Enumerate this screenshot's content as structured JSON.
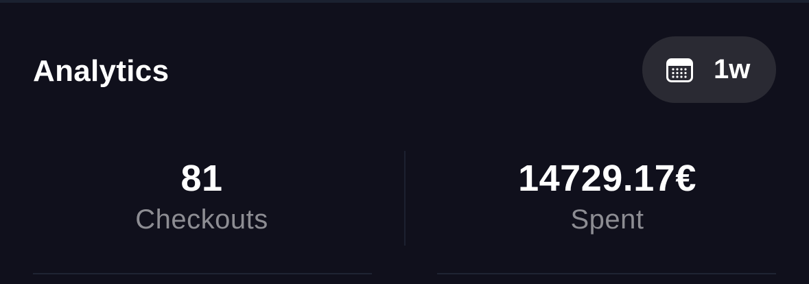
{
  "header": {
    "title": "Analytics"
  },
  "period_selector": {
    "icon": "calendar-icon",
    "value": "1w"
  },
  "stats": {
    "checkouts": {
      "value": "81",
      "label": "Checkouts"
    },
    "spent": {
      "value": "14729.17€",
      "label": "Spent"
    }
  },
  "colors": {
    "background": "#10101c",
    "pill_background": "#2a2a33",
    "label_gray": "#8d8d93",
    "divider": "#1f2433"
  }
}
